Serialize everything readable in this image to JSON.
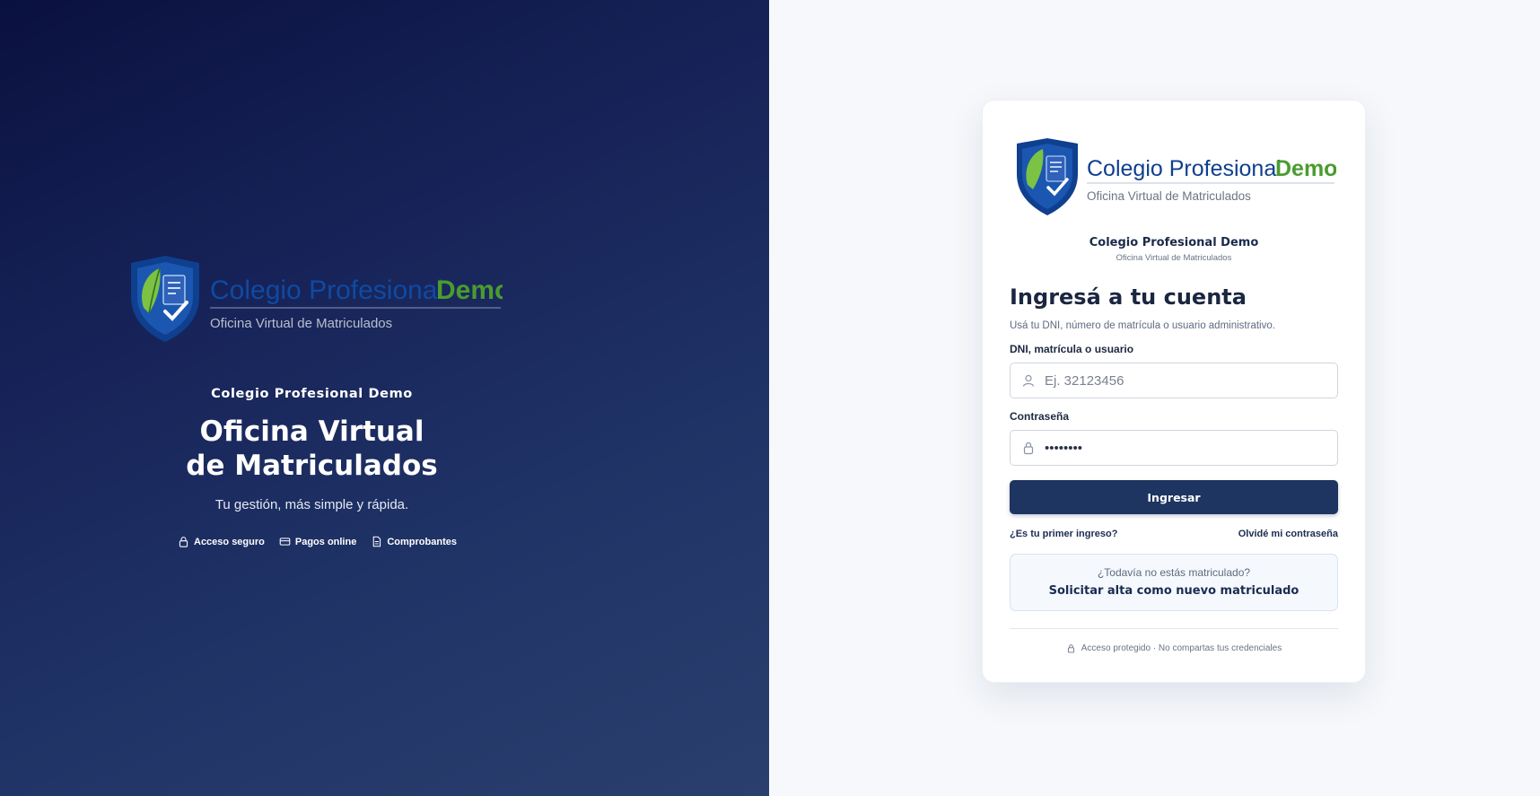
{
  "brand": {
    "logo_name": "Colegio Profesional",
    "logo_accent": "Demo",
    "logo_tagline": "Oficina Virtual de Matriculados",
    "colors": {
      "navy": "#0f3f8f",
      "green": "#4a9c2e",
      "primary": "#1e3461"
    }
  },
  "hero": {
    "org_name": "Colegio Profesional Demo",
    "title_line1": "Oficina Virtual",
    "title_line2": "de Matriculados",
    "subtitle": "Tu gestión, más simple y rápida.",
    "features": [
      {
        "icon": "lock-icon",
        "label": "Acceso seguro"
      },
      {
        "icon": "card-icon",
        "label": "Pagos online"
      },
      {
        "icon": "document-icon",
        "label": "Comprobantes"
      }
    ]
  },
  "login": {
    "org_name": "Colegio Profesional Demo",
    "org_sub": "Oficina Virtual de Matriculados",
    "heading": "Ingresá a tu cuenta",
    "help": "Usá tu DNI, número de matrícula o usuario administrativo.",
    "user_label": "DNI, matrícula o usuario",
    "user_placeholder": "Ej. 32123456",
    "user_value": "",
    "password_label": "Contraseña",
    "password_value": "••••••••",
    "submit_label": "Ingresar",
    "first_login_link": "¿Es tu primer ingreso?",
    "forgot_link": "Olvidé mi contraseña",
    "signup_question": "¿Todavía no estás matriculado?",
    "signup_cta": "Solicitar alta como nuevo matriculado",
    "footer_note": "Acceso protegido · No compartas tus credenciales"
  }
}
